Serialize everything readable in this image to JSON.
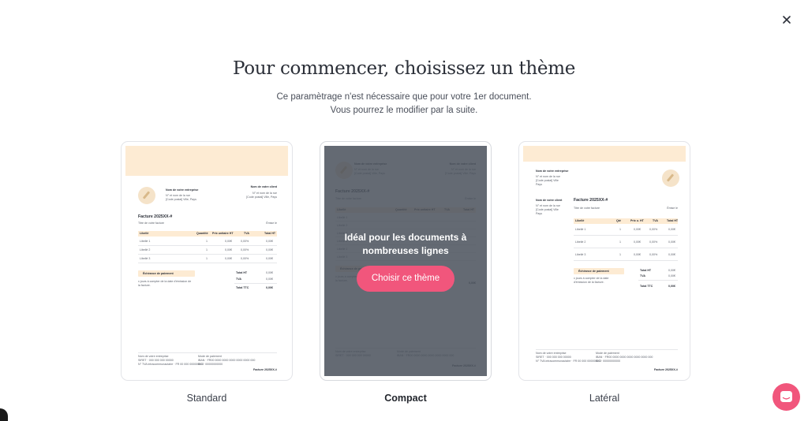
{
  "modal": {
    "title": "Pour commencer, choisissez un thème",
    "subtitle_line1": "Ce paramètrage n'est nécessaire que pour votre 1er document.",
    "subtitle_line2": "Vous pourrez le modifier par la suite.",
    "close_icon": "close-icon"
  },
  "themes": [
    {
      "name": "Standard",
      "selected": false
    },
    {
      "name": "Compact",
      "selected": true,
      "overlay_line1": "Idéal pour les documents à",
      "overlay_line2": "nombreuses lignes",
      "cta_label": "Choisir ce thème"
    },
    {
      "name": "Latéral",
      "selected": false
    }
  ],
  "preview": {
    "company_name": "Nom de votre entreprise",
    "company_addr1": "N° et nom de la rue",
    "company_addr2": "[Code postal] Ville, Pays",
    "company_addr2_lat1": "[Code postal] Ville",
    "company_addr2_lat2": "Pays",
    "client_name": "Nom de votre client",
    "client_addr1": "N° et nom de la rue",
    "client_addr2": "[Code postal] Ville, Pays",
    "client_addr2_lat1": "[Code postal] Ville",
    "client_addr2_lat2": "Pays",
    "invoice_title": "Facture 2025XX-#",
    "invoice_subtitle": "Titre de votre facture",
    "issue_label": "Émise le ",
    "col_label": "Libellé",
    "col_qty": "Quantité",
    "col_qty_short": "Qté",
    "col_unit": "Prix unitaire HT",
    "col_unit_short": "Prix u. HT",
    "col_vat": "TVA",
    "col_total": "Total HT",
    "rows": [
      {
        "label": "Libellé 1",
        "qty": "1",
        "unit": "0,00€",
        "vat": "0,00%",
        "total": "0,00€"
      },
      {
        "label": "Libellé 2",
        "qty": "1",
        "unit": "0,00€",
        "vat": "0,00%",
        "total": "0,00€"
      },
      {
        "label": "Libellé 3",
        "qty": "1",
        "unit": "0,00€",
        "vat": "0,00%",
        "total": "0,00€"
      }
    ],
    "due_label": "Échéance de paiement",
    "due_text1": "x jours à compter de la date d'émission de",
    "due_text2": "la facture.",
    "due_text_lat1": "x jours à compter de la date",
    "due_text_lat2": "d'émission de la facture.",
    "total_ht_label": "Total HT",
    "total_vat_label": "TVA",
    "total_ttc_label": "Total TTC",
    "total_ht": "0,00€",
    "total_vat": "0,00€",
    "total_ttc": "0,00€",
    "footer_col1_l1": "Nom de votre entreprise",
    "footer_col1_l2": "SIRET · 000 000 000 00000",
    "footer_col1_l3": "N° TVA intracommunautaire · FR 00 000 000000000",
    "footer_col2_l1": "Mode de paiement",
    "footer_col2_l2": "IBAN · FR00 0000 0000 0000 0000 0000 000",
    "footer_col2_l3": "BIC · 00000000000",
    "footer_ref": "Facture 2025XX-#"
  },
  "chat": {
    "icon": "chat-bubble-icon"
  }
}
